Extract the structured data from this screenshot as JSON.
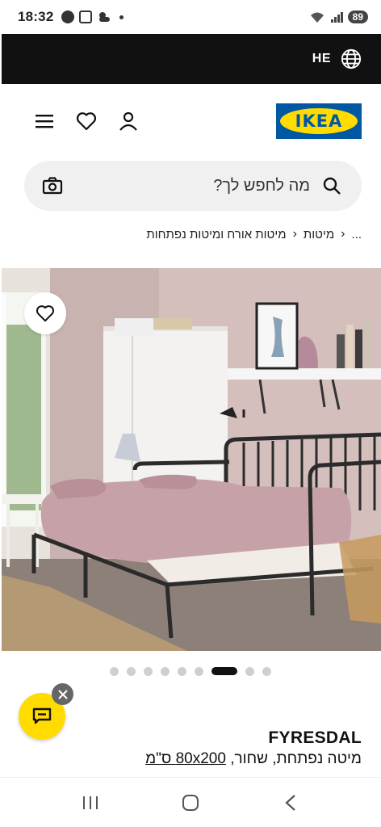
{
  "status_bar": {
    "time": "18:32",
    "battery": "89"
  },
  "lang_bar": {
    "language_code": "HE"
  },
  "header": {
    "logo_text": "IKEA"
  },
  "search": {
    "placeholder": "מה לחפש לך?"
  },
  "breadcrumb": {
    "ellipsis": "...",
    "items": [
      "מיטות",
      "מיטות אורח ומיטות נפתחות"
    ]
  },
  "gallery": {
    "total_images": 9,
    "active_index": 6
  },
  "product": {
    "name": "FYRESDAL",
    "description": "מיטה נפתחת, שחור,",
    "size": "80x200 ס\"מ"
  },
  "colors": {
    "ikea_blue": "#0058a3",
    "ikea_yellow": "#ffdb00",
    "dark": "#111111"
  }
}
